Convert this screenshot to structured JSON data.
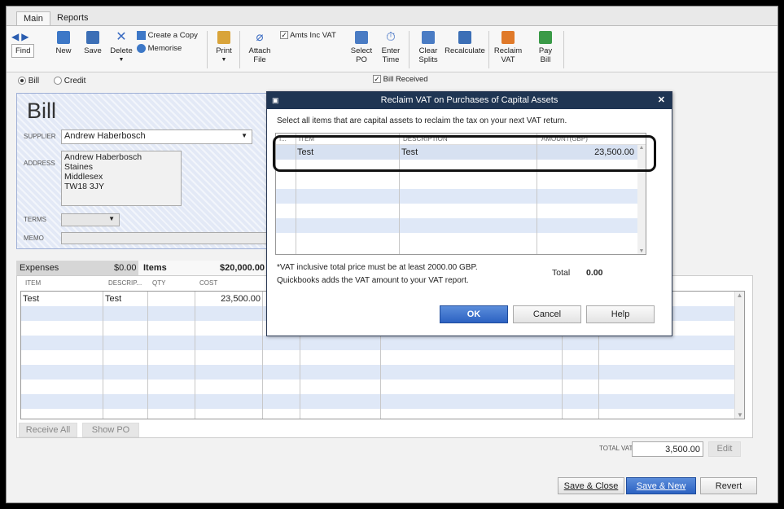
{
  "tabs": [
    "Main",
    "Reports"
  ],
  "toolbar": {
    "find": "Find",
    "new": "New",
    "save": "Save",
    "delete": "Delete",
    "create_copy": "Create a Copy",
    "memorise": "Memorise",
    "print": "Print",
    "attach_file": [
      "Attach",
      "File"
    ],
    "amts_inc_vat": "Amts Inc VAT",
    "select_po": [
      "Select",
      "PO"
    ],
    "enter_time": [
      "Enter",
      "Time"
    ],
    "clear_splits": [
      "Clear",
      "Splits"
    ],
    "recalculate": "Recalculate",
    "reclaim_vat": [
      "Reclaim",
      "VAT"
    ],
    "pay_bill": [
      "Pay",
      "Bill"
    ]
  },
  "form": {
    "bill_radio": "Bill",
    "credit_radio": "Credit",
    "bill_received": "Bill Received",
    "title": "Bill",
    "supplier_label": "SUPPLIER",
    "supplier_value": "Andrew Haberbosch",
    "address_label": "ADDRESS",
    "address_lines": [
      "Andrew Haberbosch",
      "Staines",
      "Middlesex",
      "TW18 3JY"
    ],
    "terms_label": "TERMS",
    "memo_label": "MEMO"
  },
  "lines": {
    "expenses_tab": "Expenses",
    "expenses_amount": "$0.00",
    "items_tab": "Items",
    "items_amount": "$20,000.00",
    "headers": [
      "ITEM",
      "DESCRIP...",
      "QTY",
      "COST"
    ],
    "rows": [
      {
        "item": "Test",
        "description": "Test",
        "qty": "",
        "cost": "23,500.00"
      }
    ],
    "receive_all": "Receive All",
    "show_po": "Show PO"
  },
  "footer": {
    "total_vat_label": "TOTAL VAT",
    "total_vat_value": "3,500.00",
    "edit": "Edit",
    "save_close": "Save & Close",
    "save_new": "Save & New",
    "revert": "Revert"
  },
  "dialog": {
    "title": "Reclaim VAT on Purchases of Capital Assets",
    "instruction": "Select all items that are capital assets to reclaim the tax on your next VAT return.",
    "headers": [
      "I...",
      "ITEM",
      "DESCRIPTION",
      "AMOUNT(GBP)"
    ],
    "rows": [
      {
        "item": "Test",
        "description": "Test",
        "amount": "23,500.00"
      }
    ],
    "note1": "*VAT inclusive total price must be at least 2000.00 GBP.",
    "note2": "Quickbooks adds the VAT amount to your VAT report.",
    "total_label": "Total",
    "total_value": "0.00",
    "ok": "OK",
    "cancel": "Cancel",
    "help": "Help"
  },
  "colors": {
    "accent": "#2c62c2",
    "dialog_title_bg": "#1f3553",
    "bill_panel": "#e3e9f6",
    "row_band": "#dfe8f7"
  }
}
